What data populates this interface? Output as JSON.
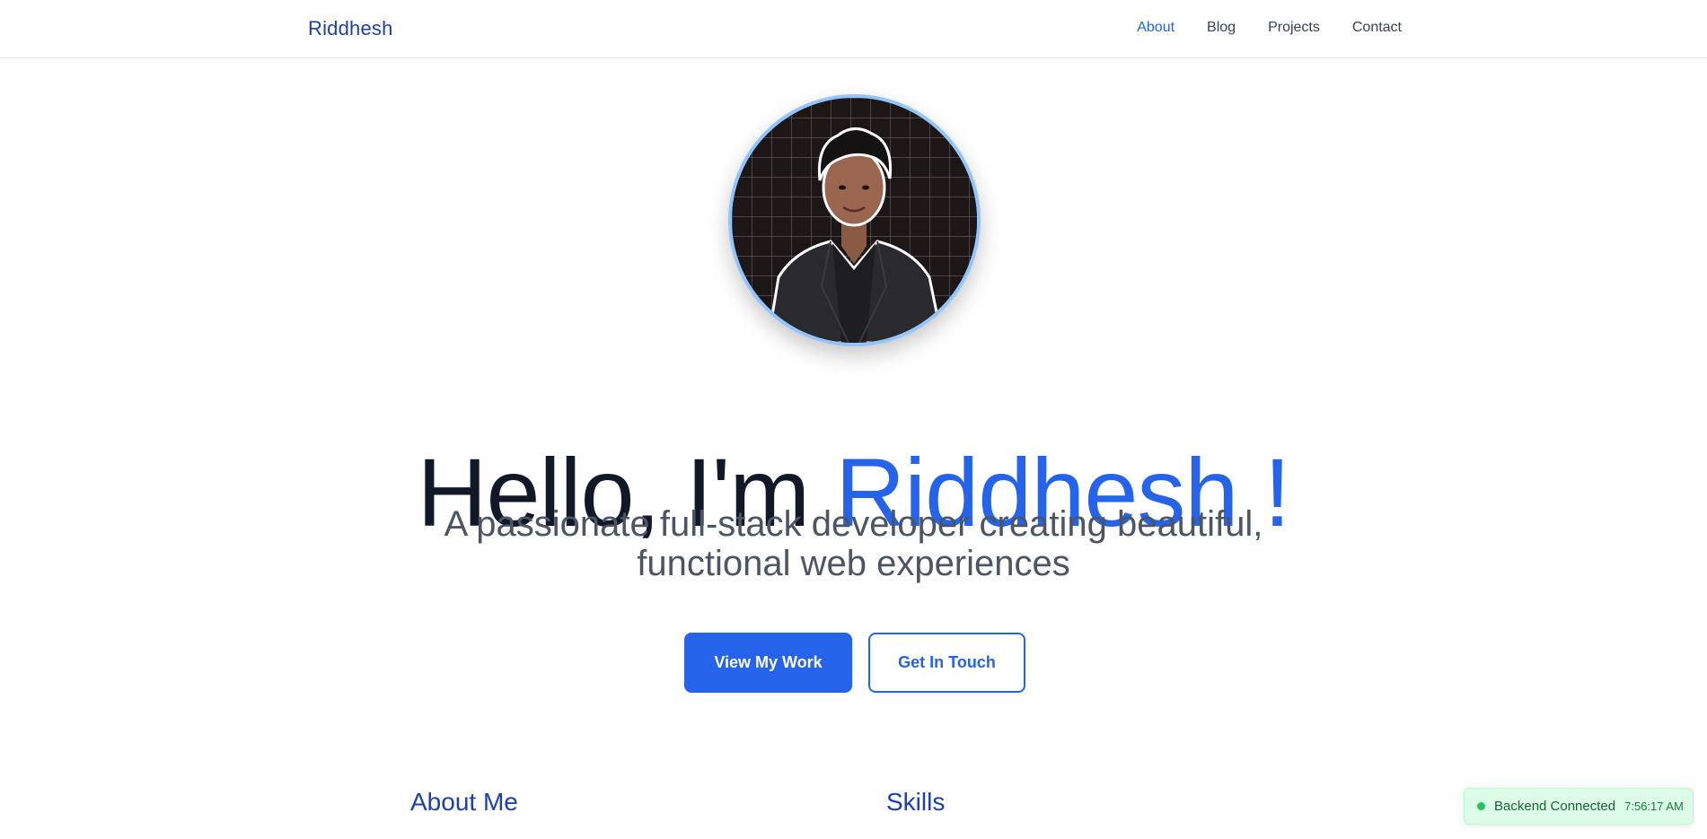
{
  "navbar": {
    "brand": "Riddhesh",
    "links": [
      {
        "label": "About",
        "active": true
      },
      {
        "label": "Blog",
        "active": false
      },
      {
        "label": "Projects",
        "active": false
      },
      {
        "label": "Contact",
        "active": false
      }
    ]
  },
  "hero": {
    "avatar_icon": "profile-photo",
    "greeting": "Hello, I'm ",
    "name": "Riddhesh !",
    "subtitle_line1": "A passionate full-stack developer creating beautiful,",
    "subtitle_line2": "functional web experiences",
    "primary_button": "View My Work",
    "secondary_button": "Get In Touch"
  },
  "sections": {
    "about_heading": "About Me",
    "skills_heading": "Skills"
  },
  "status": {
    "text": "Backend Connected",
    "time": "7:56:17 AM",
    "color": "#22c55e"
  },
  "colors": {
    "accent": "#2563eb",
    "brand": "#1e40af"
  }
}
